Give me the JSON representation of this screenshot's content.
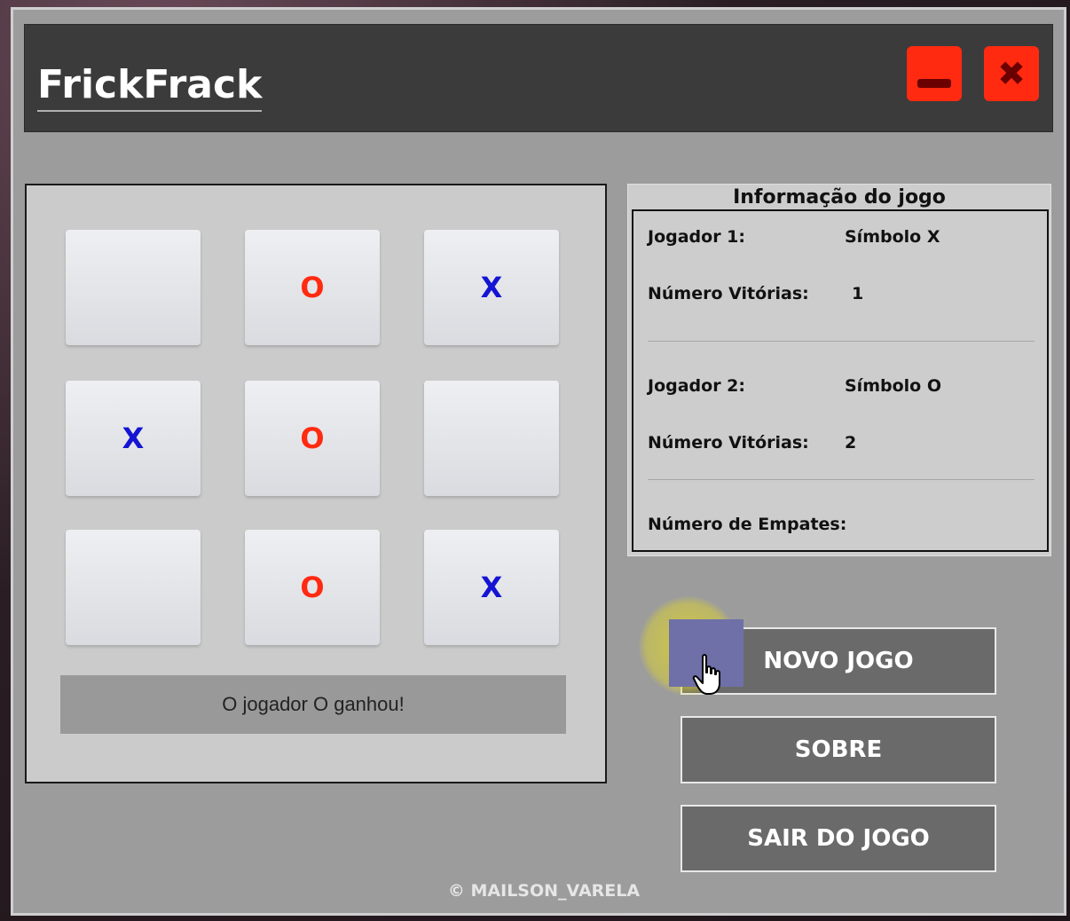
{
  "app": {
    "title": "FrickFrack"
  },
  "window_controls": {
    "minimize_icon": "minimize-icon",
    "close_icon": "close-icon",
    "close_glyph": "✖",
    "accent_color": "#ff2a10"
  },
  "board": {
    "cells": [
      "",
      "O",
      "X",
      "X",
      "O",
      "",
      "",
      "O",
      "X"
    ],
    "x_color": "#1414d2",
    "o_color": "#ff2a10",
    "status": "O jogador O ganhou!"
  },
  "info": {
    "heading": "Informação do jogo",
    "player1": {
      "label": "Jogador 1:",
      "symbol": "Símbolo X",
      "wins_label": "Número Vitórias:",
      "wins": "1"
    },
    "player2": {
      "label": "Jogador 2:",
      "symbol": "Símbolo O",
      "wins_label": "Número Vitórias:",
      "wins": "2"
    },
    "draws_label": "Número de Empates:",
    "draws": ""
  },
  "buttons": {
    "new_game": "NOVO JOGO",
    "about": "SOBRE",
    "exit": "SAIR DO JOGO"
  },
  "footer": {
    "copyright": "© MAILSON_VARELA"
  },
  "cursor": {
    "icon": "hand-pointer-icon"
  }
}
